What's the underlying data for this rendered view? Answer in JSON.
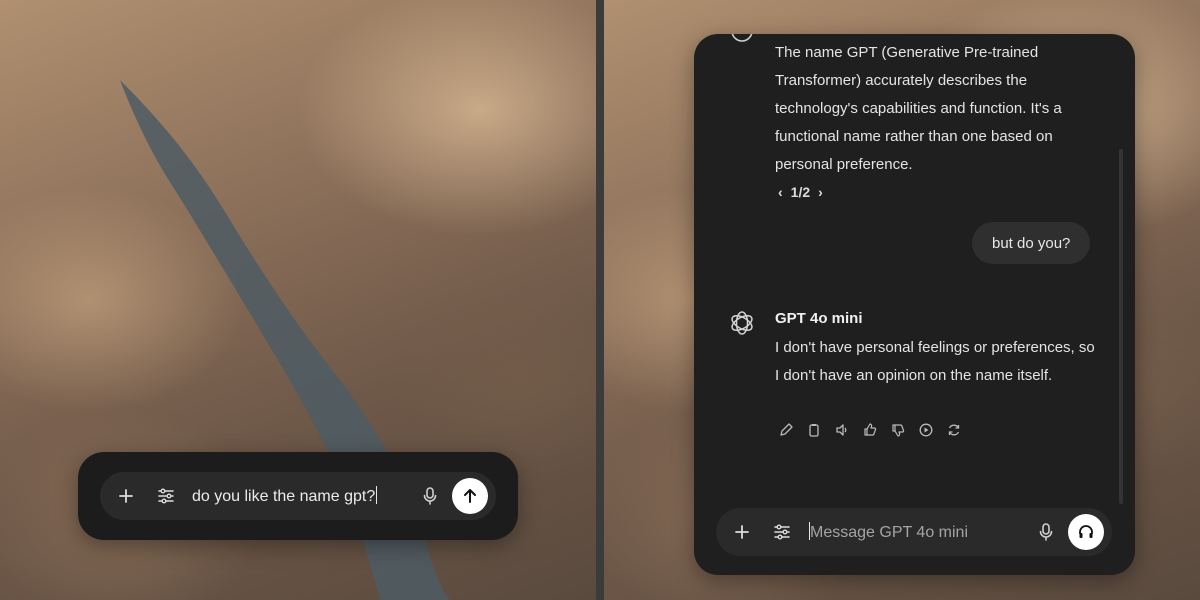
{
  "left": {
    "input": {
      "value": "do you like the name gpt?"
    },
    "buttons": {
      "add": "add-icon",
      "tools": "sliders-icon",
      "mic": "mic-icon",
      "send": "arrow-up-icon"
    }
  },
  "right": {
    "previous_reply": "The name GPT (Generative Pre-trained Transformer) accurately describes the technology's capabilities and function. It's a functional name rather than one based on personal preference.",
    "pager": "1/2",
    "user_message": "but do you?",
    "assistant": {
      "name": "GPT 4o mini",
      "reply": "I don't have personal feelings or preferences, so I don't have an opinion on the name itself."
    },
    "actions": [
      "edit-icon",
      "copy-icon",
      "speaker-icon",
      "thumbs-up-icon",
      "thumbs-down-icon",
      "play-icon",
      "regenerate-icon"
    ],
    "composer": {
      "placeholder": "Message GPT 4o mini"
    }
  },
  "colors": {
    "panel": "#1f1f1f",
    "input": "#2a2a2a",
    "bubble": "#2f2f2f",
    "text": "#e4e4e4"
  }
}
